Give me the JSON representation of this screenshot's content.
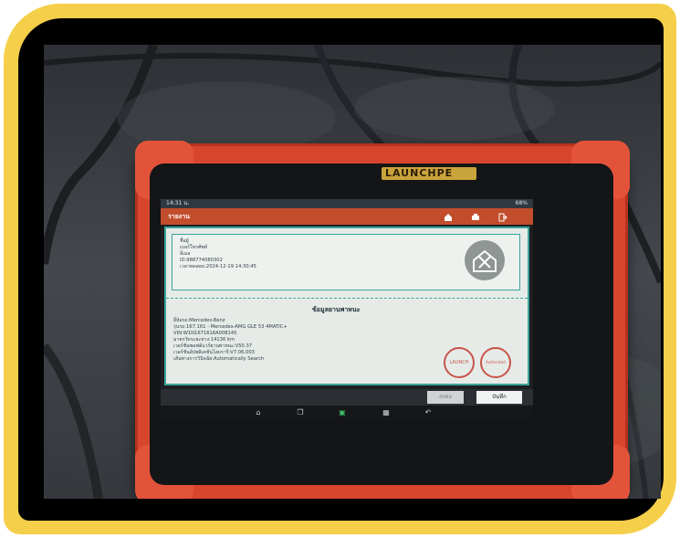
{
  "device": {
    "brand": "LAUNCHPE",
    "status_time": "14:31 น.",
    "battery": "68%"
  },
  "app": {
    "title": "รายงาน",
    "icons": [
      "home-icon",
      "print-icon",
      "exit-icon"
    ]
  },
  "report": {
    "info_lines": [
      "ชื่อผู้",
      "เบอร์โทรศัพท์",
      "อีเมล",
      "ID:988774080302",
      "เวลาทดสอบ:2024-12-19 14:30:45"
    ],
    "section_title": "ข้อมูลยานพาหนะ",
    "vehicle_lines": [
      "ยี่ห้อรถ:Mercedes-Benz",
      "รุ่นรถ:167.161 - Mercedes-AMG GLE 53 4MATIC+",
      "VIN:W1N1671616A008145",
      "มาตรวัดระยะทาง:14136 km",
      "เวอร์ชันซอฟต์แวร์ยานพาหนะ:V50.37",
      "เวอร์ชันอัปพลิเคชันไลบรารี:V7.06.003",
      "เส้นทางการวินิจฉัย:Automatically Search"
    ],
    "stamps": [
      "LAUNCH",
      "Authorized"
    ]
  },
  "buttons": {
    "share": "ส่งต่อ",
    "save": "บันทึก"
  },
  "nav_icons": [
    "home-icon",
    "recent-apps-icon",
    "car-diagnostic-icon",
    "gallery-icon",
    "back-icon"
  ]
}
